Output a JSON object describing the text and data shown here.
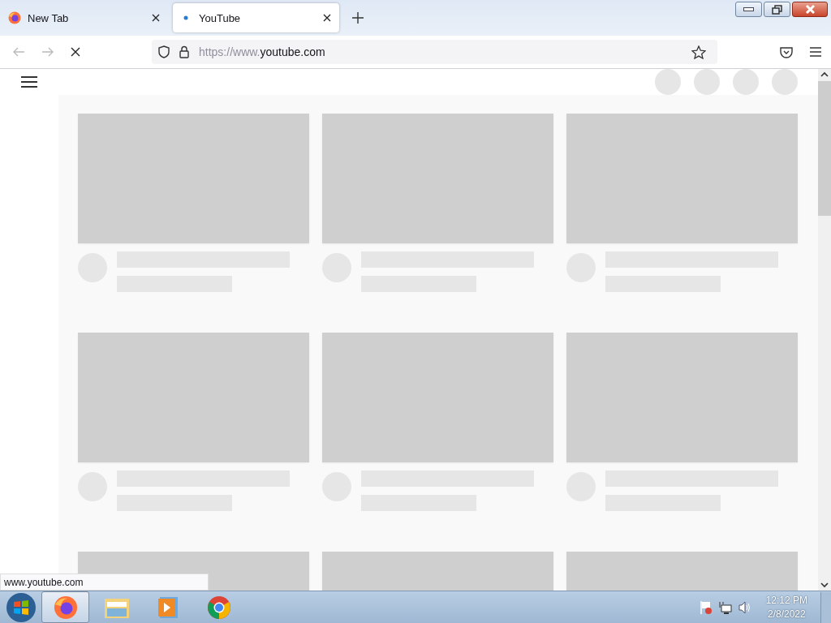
{
  "window": {
    "controls": [
      {
        "kind": "minimize"
      },
      {
        "kind": "restore"
      },
      {
        "kind": "close"
      }
    ]
  },
  "tabs": [
    {
      "title": "New Tab",
      "selected": false
    },
    {
      "title": "YouTube",
      "selected": true
    }
  ],
  "toolbar": {
    "url_scheme": "https://www.",
    "url_host": "youtube.com",
    "loading": true
  },
  "page": {
    "header_placeholders": [
      {
        "kind": "circle"
      },
      {
        "kind": "circle"
      },
      {
        "kind": "circle"
      },
      {
        "kind": "circle"
      }
    ],
    "feed_items": [
      {
        "kind": "full"
      },
      {
        "kind": "full"
      },
      {
        "kind": "full"
      },
      {
        "kind": "full"
      },
      {
        "kind": "full"
      },
      {
        "kind": "full"
      },
      {
        "kind": "thumb"
      },
      {
        "kind": "thumb"
      },
      {
        "kind": "thumb"
      }
    ]
  },
  "status_text": "www.youtube.com",
  "taskbar": {
    "apps": [
      {
        "kind": "firefox",
        "selected": true
      },
      {
        "kind": "folder",
        "selected": false
      },
      {
        "kind": "media",
        "selected": false
      },
      {
        "kind": "chrome",
        "selected": false
      }
    ],
    "time": "12:12 PM",
    "date": "2/8/2022"
  }
}
